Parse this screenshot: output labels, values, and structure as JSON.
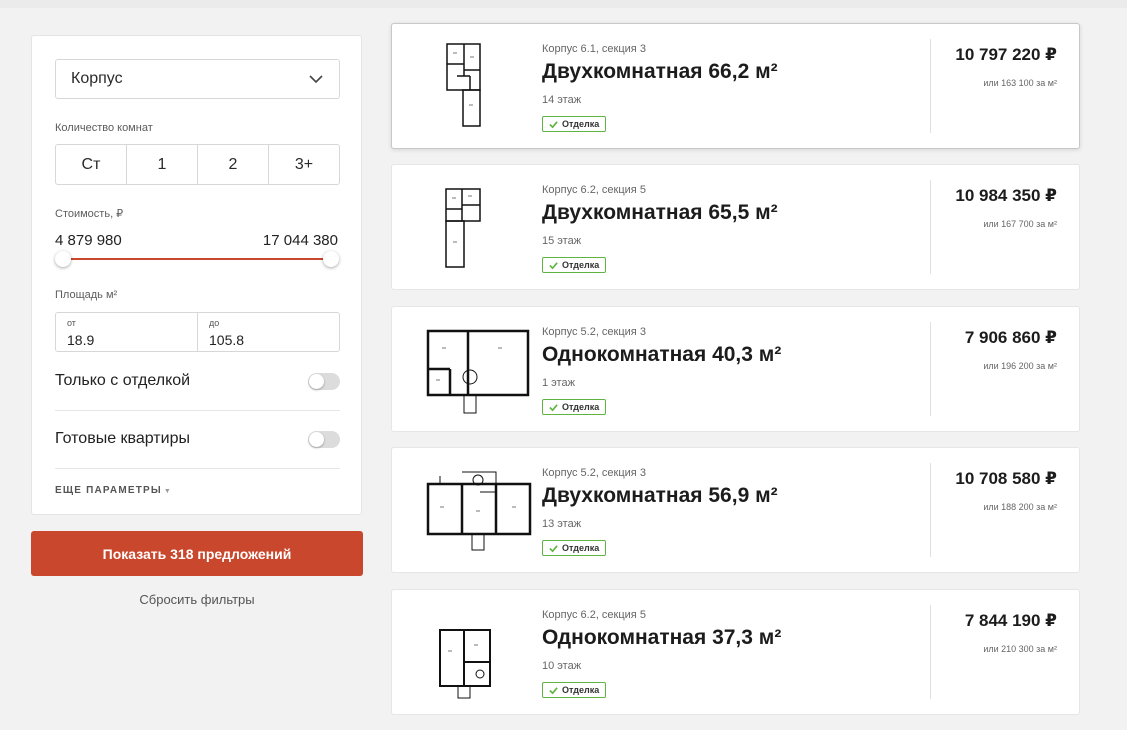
{
  "filters": {
    "building_select": {
      "value": "Корпус"
    },
    "rooms": {
      "label": "Количество комнат",
      "options": [
        "Ст",
        "1",
        "2",
        "3+"
      ]
    },
    "price": {
      "label": "Стоимость, ₽",
      "min": "4 879 980",
      "max": "17 044 380"
    },
    "area": {
      "label": "Площадь м²",
      "from_label": "от",
      "from_value": "18.9",
      "to_label": "до",
      "to_value": "105.8"
    },
    "only_finished": {
      "label": "Только с отделкой",
      "on": false
    },
    "ready": {
      "label": "Готовые квартиры",
      "on": false
    },
    "more_params": "ЕЩЕ ПАРАМЕТРЫ",
    "show_button": "Показать 318 предложений",
    "reset": "Сбросить фильтры"
  },
  "listings": [
    {
      "building": "Корпус 6.1, секция 3",
      "title": "Двухкомнатная 66,2 м²",
      "floor": "14 этаж",
      "badge": "Отделка",
      "price": "10 797 220 ₽",
      "per_m2": "или 163 100 за м²"
    },
    {
      "building": "Корпус 6.2, секция 5",
      "title": "Двухкомнатная 65,5 м²",
      "floor": "15 этаж",
      "badge": "Отделка",
      "price": "10 984 350 ₽",
      "per_m2": "или 167 700 за м²"
    },
    {
      "building": "Корпус 5.2, секция 3",
      "title": "Однокомнатная 40,3 м²",
      "floor": "1 этаж",
      "badge": "Отделка",
      "price": "7 906 860 ₽",
      "per_m2": "или 196 200 за м²"
    },
    {
      "building": "Корпус 5.2, секция 3",
      "title": "Двухкомнатная 56,9 м²",
      "floor": "13 этаж",
      "badge": "Отделка",
      "price": "10 708 580 ₽",
      "per_m2": "или 188 200 за м²"
    },
    {
      "building": "Корпус 6.2, секция 5",
      "title": "Однокомнатная 37,3 м²",
      "floor": "10 этаж",
      "badge": "Отделка",
      "price": "7 844 190 ₽",
      "per_m2": "или 210 300 за м²"
    }
  ],
  "colors": {
    "accent": "#c9472c",
    "badge_border": "#5fb43f"
  },
  "icons": {
    "select": "chevron-down-icon",
    "badge": "check-icon",
    "plan": "floor-plan-icon"
  }
}
